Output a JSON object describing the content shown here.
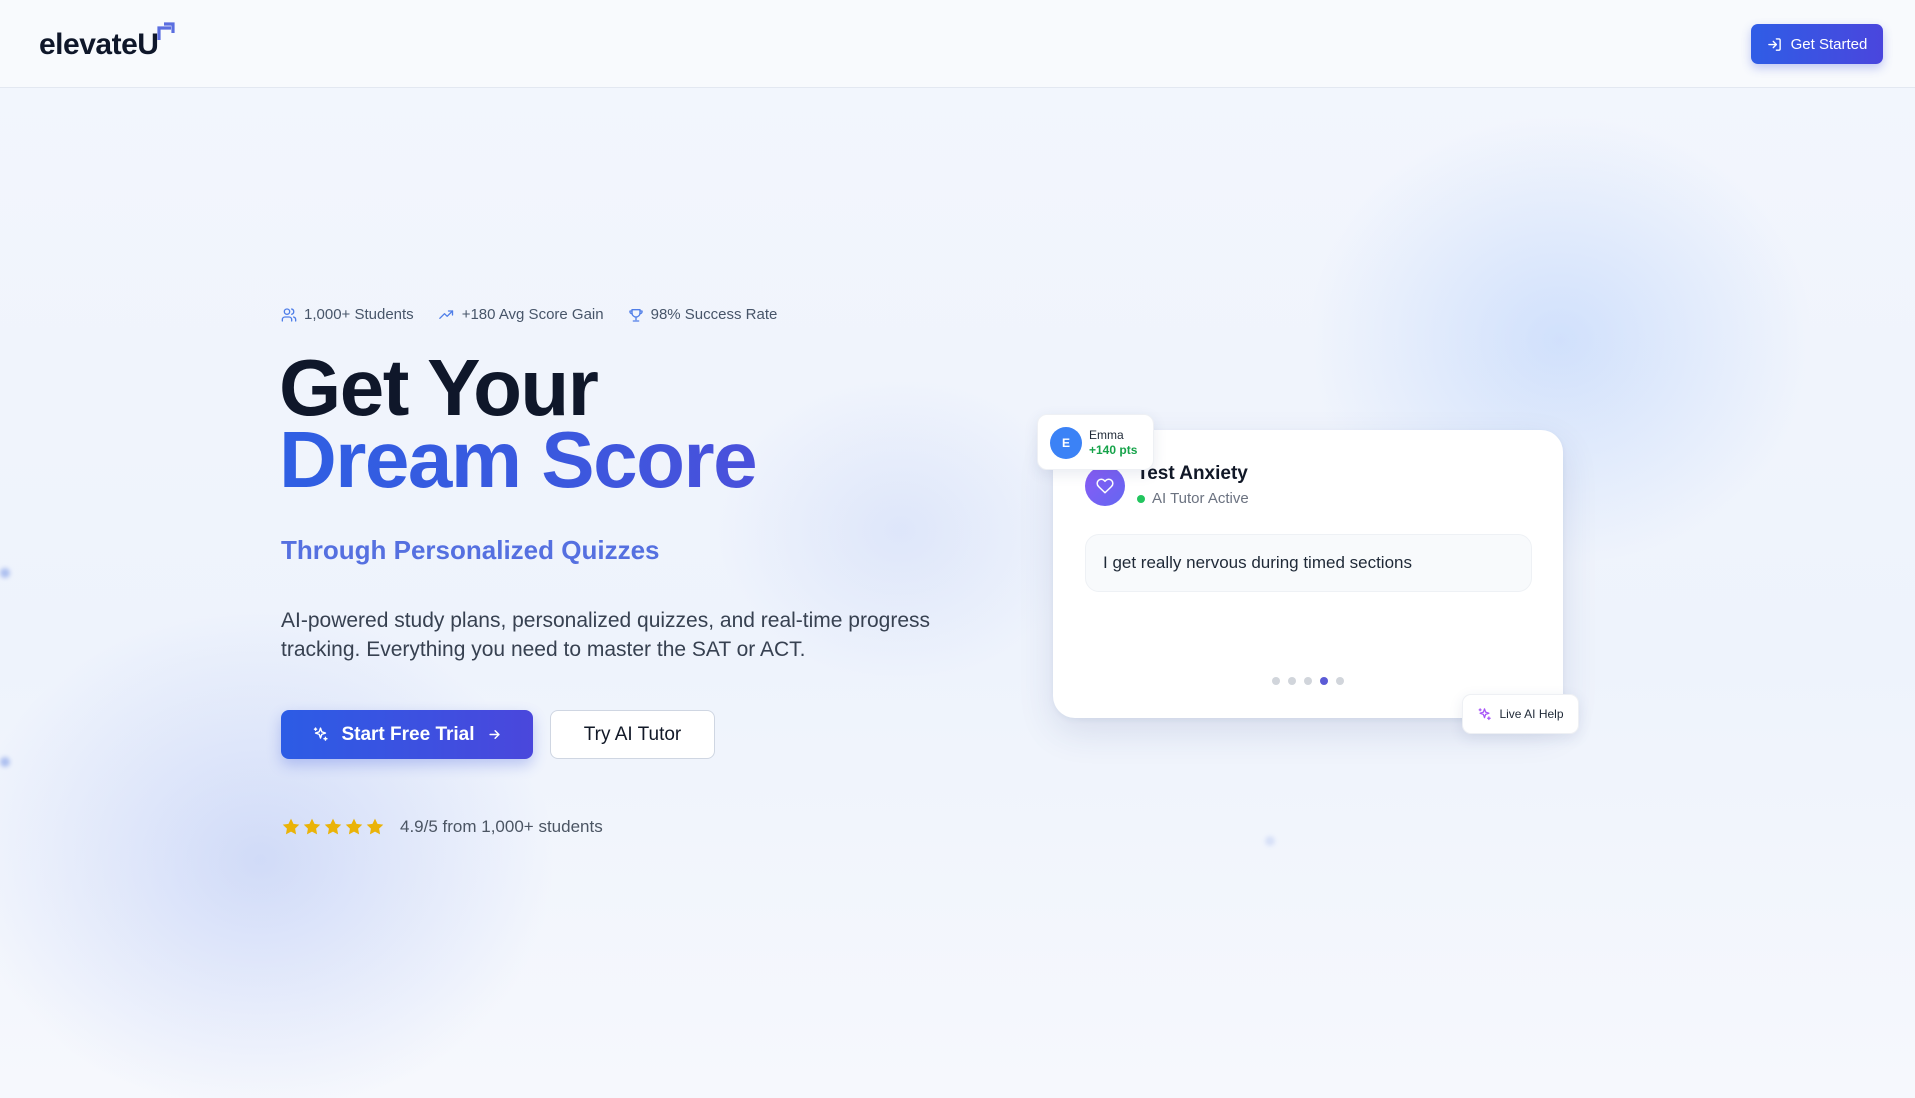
{
  "header": {
    "logo_text": "elevateU",
    "cta_label": "Get Started"
  },
  "hero": {
    "stats": [
      {
        "icon": "users-icon",
        "label": "1,000+ Students"
      },
      {
        "icon": "trending-up-icon",
        "label": "+180 Avg Score Gain"
      },
      {
        "icon": "trophy-icon",
        "label": "98% Success Rate"
      }
    ],
    "title_line1": "Get Your",
    "title_line2": "Dream Score",
    "subtitle": "Through Personalized Quizzes",
    "description": "AI-powered study plans, personalized quizzes, and real-time progress tracking. Everything you need to master the SAT or ACT.",
    "primary_cta": "Start Free Trial",
    "secondary_cta": "Try AI Tutor",
    "rating": {
      "stars": 5,
      "text": "4.9/5 from 1,000+ students"
    }
  },
  "card": {
    "title": "Test Anxiety",
    "status": "AI Tutor Active",
    "message": "I get really nervous during timed sections",
    "carousel": {
      "count": 5,
      "active_index": 3
    }
  },
  "emma_badge": {
    "initial": "E",
    "name": "Emma",
    "points": "+140 pts"
  },
  "live_badge": {
    "label": "Live AI Help"
  },
  "colors": {
    "primary": "#2f5de6",
    "primary_end": "#4a47dc",
    "subtitle": "#5570e0",
    "star": "#eab308",
    "success": "#16a34a"
  }
}
